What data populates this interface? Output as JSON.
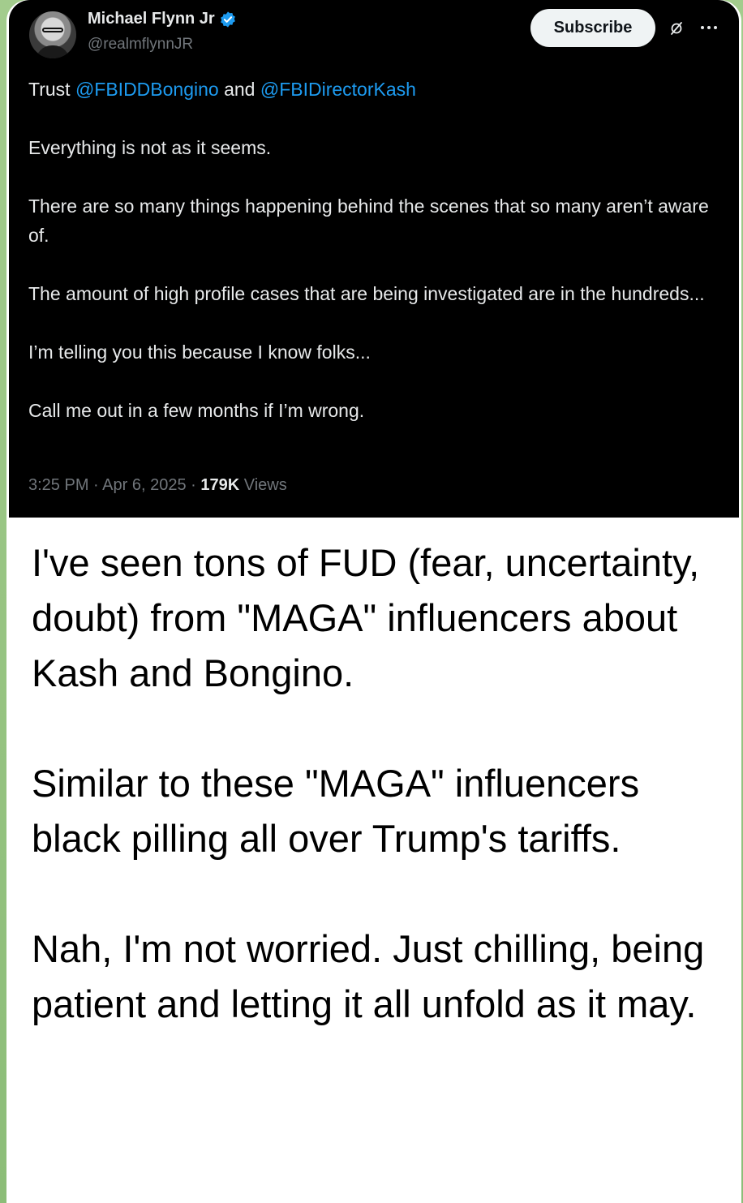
{
  "tweet": {
    "author_name": "Michael Flynn Jr",
    "author_handle": "@realmflynnJR",
    "subscribe_label": "Subscribe",
    "line1_prefix": "Trust ",
    "mention1": "@FBIDDBongino",
    "line1_mid": " and ",
    "mention2": "@FBIDirectorKash",
    "paragraph2": "Everything is not as it seems.",
    "paragraph3": "There are so many things happening behind the scenes that so many aren’t aware of.",
    "paragraph4": "The amount of high profile cases that are being investigated are in the hundreds...",
    "paragraph5": "I’m telling you this because I know folks...",
    "paragraph6": "Call me out in a few months if I’m wrong.",
    "timestamp": "3:25 PM · Apr 6, 2025 · ",
    "views_count": "179K",
    "views_label": " Views",
    "colors": {
      "background": "#000000",
      "link": "#1d9bf0",
      "verified": "#1d9bf0"
    }
  },
  "caption": {
    "paragraph1": "I've seen tons of FUD (fear, uncertainty, doubt) from \"MAGA\" influencers about Kash and Bongino.",
    "paragraph2": "Similar to these \"MAGA\" influencers black pilling all over Trump's tariffs.",
    "paragraph3": "Nah, I'm not worried. Just chilling, being patient and letting it all unfold as it may."
  },
  "icons": {
    "verified": "verified-badge-icon",
    "grok": "grok-icon",
    "more": "more-options-icon"
  }
}
